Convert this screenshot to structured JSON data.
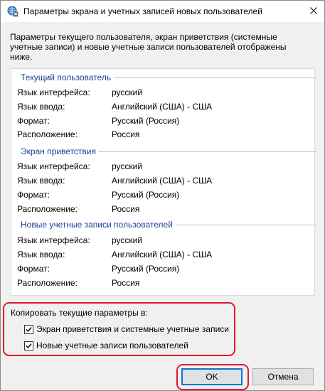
{
  "window": {
    "title": "Параметры экрана и учетных записей новых пользователей",
    "icon": "globe-settings-icon",
    "close_icon": "close-icon"
  },
  "description": "Параметры текущего пользователя, экран приветствия (системные учетные записи) и новые учетные записи пользователей отображены ниже.",
  "labels": {
    "ui_language": "Язык интерфейса:",
    "input_language": "Язык ввода:",
    "format": "Формат:",
    "location": "Расположение:"
  },
  "groups": [
    {
      "title": "Текущий пользователь",
      "ui_language": "русский",
      "input_language": "Английский (США) - США",
      "format": "Русский (Россия)",
      "location": "Россия"
    },
    {
      "title": "Экран приветствия",
      "ui_language": "русский",
      "input_language": "Английский (США) - США",
      "format": "Русский (Россия)",
      "location": "Россия"
    },
    {
      "title": "Новые учетные записи пользователей",
      "ui_language": "русский",
      "input_language": "Английский (США) - США",
      "format": "Русский (Россия)",
      "location": "Россия"
    }
  ],
  "copy": {
    "label": "Копировать текущие параметры в:",
    "options": [
      {
        "label": "Экран приветствия и системные учетные записи",
        "checked": true
      },
      {
        "label": "Новые учетные записи пользователей",
        "checked": true
      }
    ]
  },
  "buttons": {
    "ok": "OK",
    "cancel": "Отмена"
  },
  "colors": {
    "group_title": "#1f3e94",
    "highlight": "#e0192f",
    "default_button_border": "#0078d7"
  }
}
